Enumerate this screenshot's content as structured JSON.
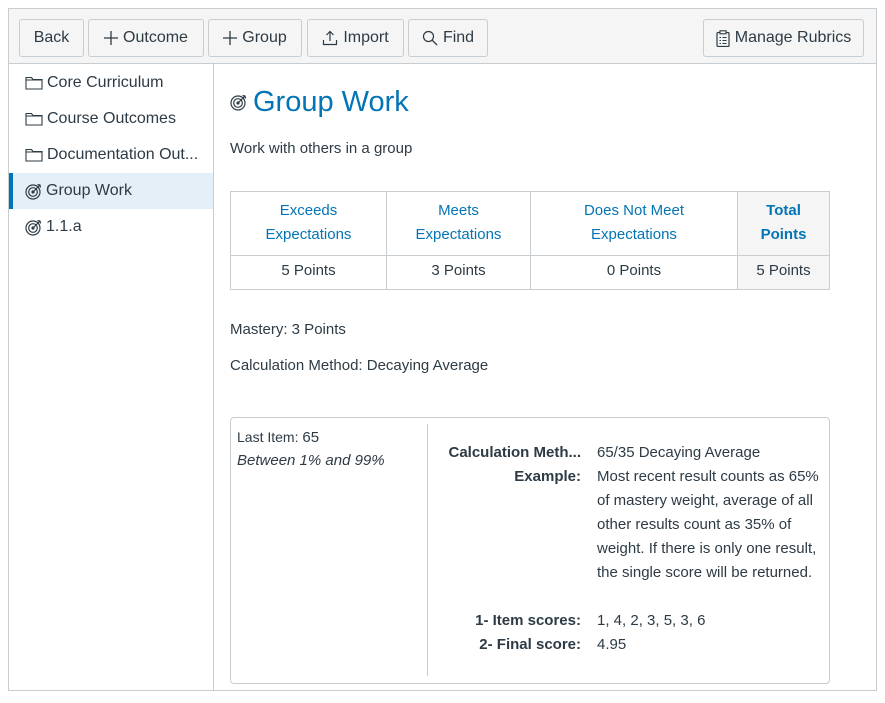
{
  "toolbar": {
    "back_label": "Back",
    "outcome_label": "Outcome",
    "group_label": "Group",
    "import_label": "Import",
    "find_label": "Find",
    "manage_rubrics_label": "Manage Rubrics"
  },
  "sidebar": {
    "items": [
      {
        "label": "Core Curriculum",
        "icon": "folder-icon"
      },
      {
        "label": "Course Outcomes",
        "icon": "folder-icon"
      },
      {
        "label": "Documentation Out...",
        "icon": "folder-icon"
      },
      {
        "label": "Group Work",
        "icon": "outcome-icon",
        "active": true
      },
      {
        "label": "1.1.a",
        "icon": "outcome-icon"
      }
    ]
  },
  "outcome": {
    "title": "Group Work",
    "description": "Work with others in a group",
    "ratings": [
      {
        "line1": "Exceeds",
        "line2": "Expectations",
        "points": "5 Points"
      },
      {
        "line1": "Meets",
        "line2": "Expectations",
        "points": "3 Points"
      },
      {
        "line1": "Does Not Meet",
        "line2": "Expectations",
        "points": "0 Points"
      }
    ],
    "total": {
      "line1": "Total",
      "line2": "Points",
      "points": "5 Points"
    },
    "mastery": "Mastery: 3 Points",
    "calculation_method": "Calculation Method: Decaying Average"
  },
  "calculation": {
    "last_item_label": "Last Item:",
    "last_item_value": "65",
    "range": "Between 1% and 99%",
    "method_label": "Calculation Meth...",
    "method_value": "65/35 Decaying Average",
    "example_label": "Example:",
    "example_value": "Most recent result counts as 65% of mastery weight, average of all other results count as 35% of weight. If there is only one result, the single score will be returned.",
    "item_scores_label": "1- Item scores:",
    "item_scores_value": "1, 4, 2, 3, 5, 3, 6",
    "final_score_label": "2- Final score:",
    "final_score_value": "4.95"
  },
  "colors": {
    "accent": "#0374b5",
    "text": "#2d3b45",
    "border": "#c7cdd1",
    "active_bg": "#e5eff7"
  }
}
